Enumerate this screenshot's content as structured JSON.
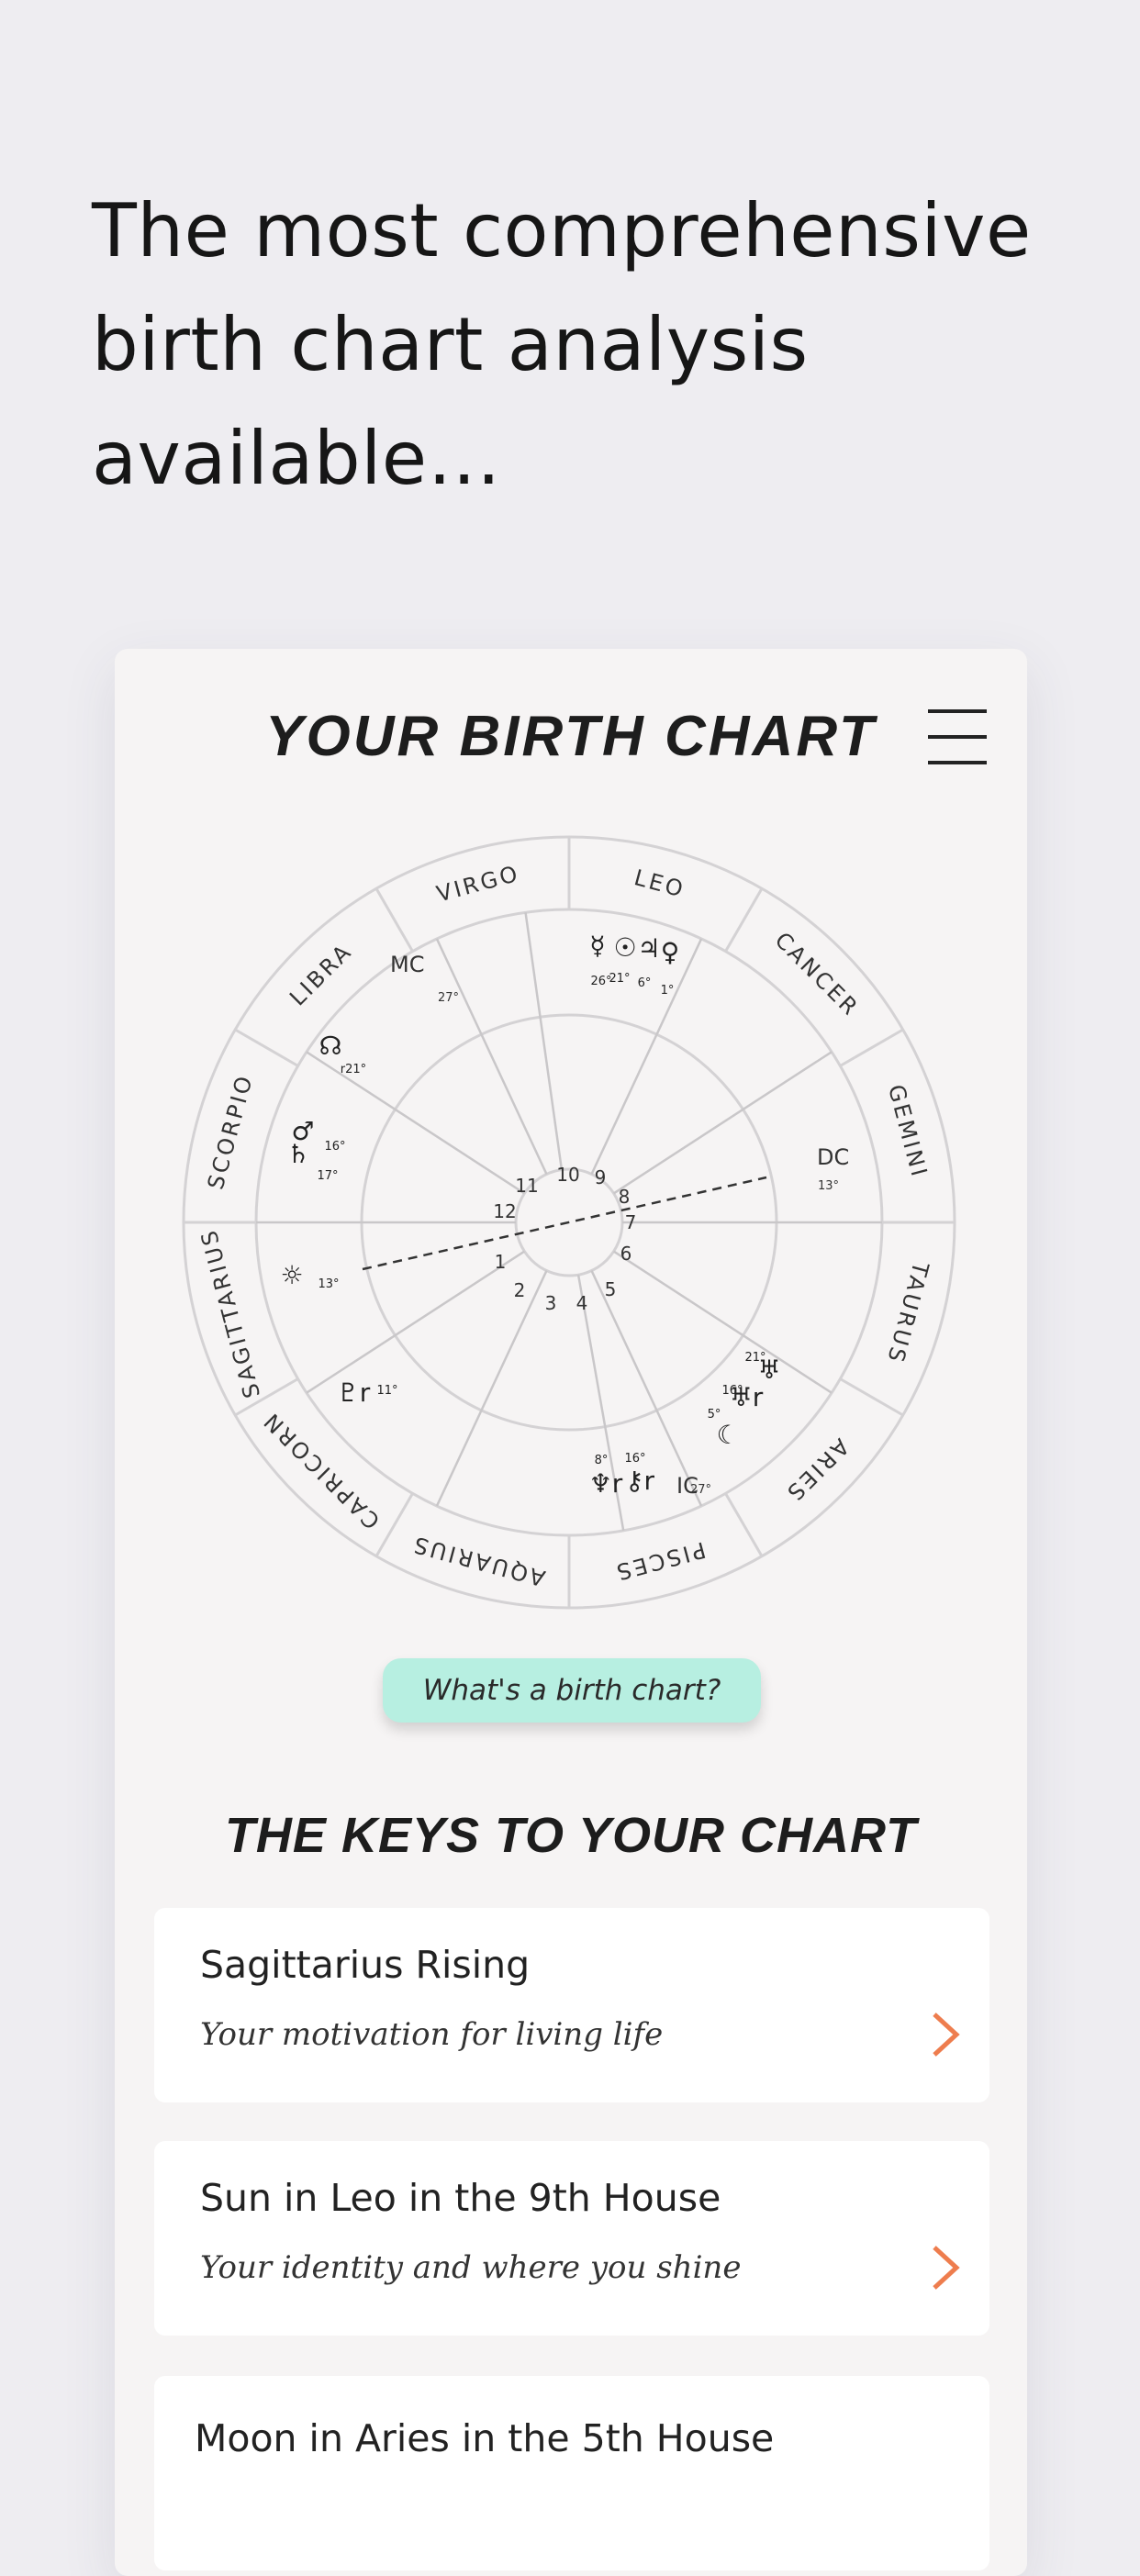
{
  "headline": "The most comprehensive birth chart analysis available…",
  "card": {
    "title": "YOUR BIRTH CHART",
    "help_button": "What's a birth chart?",
    "keys_title": "THE KEYS TO YOUR CHART",
    "keys": [
      {
        "title": "Sagittarius Rising",
        "subtitle": "Your motivation for living life"
      },
      {
        "title": "Sun in Leo in the 9th House",
        "subtitle": "Your identity and where you shine"
      },
      {
        "title": "Moon in Aries in the 5th House",
        "subtitle": ""
      }
    ]
  },
  "chart": {
    "signs": [
      "LEO",
      "CANCER",
      "GEMINI",
      "TAURUS",
      "ARIES",
      "PISCES",
      "AQUARIUS",
      "CAPRICORN",
      "SAGITTARIUS",
      "SCORPIO",
      "LIBRA",
      "VIRGO"
    ],
    "house_numbers": [
      "1",
      "2",
      "3",
      "4",
      "5",
      "6",
      "7",
      "8",
      "9",
      "10",
      "11",
      "12"
    ],
    "angles": [
      {
        "label": "MC",
        "degree": "27°"
      },
      {
        "label": "DC",
        "degree": "13°"
      },
      {
        "label": "IC",
        "degree": "27°"
      }
    ],
    "planets": [
      {
        "name": "mercury",
        "glyph": "☿",
        "degree": "26°"
      },
      {
        "name": "sun",
        "glyph": "☉",
        "degree": "21°"
      },
      {
        "name": "jupiter",
        "glyph": "♃",
        "degree": "6°"
      },
      {
        "name": "venus",
        "glyph": "♀",
        "degree": "1°"
      },
      {
        "name": "north-node",
        "glyph": "☊",
        "degree": "r21°"
      },
      {
        "name": "mars",
        "glyph": "♂",
        "degree": "16°"
      },
      {
        "name": "saturn",
        "glyph": "♄",
        "degree": "17°"
      },
      {
        "name": "ascendant-sun",
        "glyph": "☼",
        "degree": "13°"
      },
      {
        "name": "pluto",
        "glyph": "♇r",
        "degree": "11°"
      },
      {
        "name": "neptune",
        "glyph": "♆r",
        "degree": "8°"
      },
      {
        "name": "chiron",
        "glyph": "⚷r",
        "degree": "16°"
      },
      {
        "name": "moon",
        "glyph": "☾",
        "degree": "5°"
      },
      {
        "name": "uranus",
        "glyph": "♅r",
        "degree": "16°"
      },
      {
        "name": "uranus-2",
        "glyph": "♅",
        "degree": "21°"
      }
    ]
  },
  "colors": {
    "background": "#eeedf1",
    "card": "#f6f4f4",
    "pill": "#b7efe1",
    "chevron": "#ee7d4e"
  }
}
